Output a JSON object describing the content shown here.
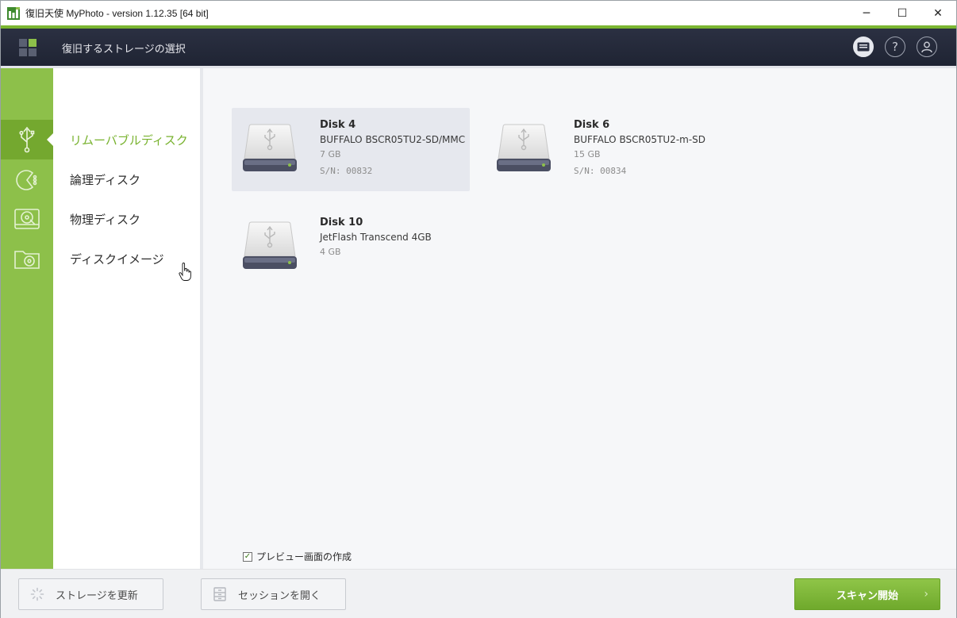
{
  "window": {
    "title": "復旧天使 MyPhoto - version 1.12.35 [64 bit]",
    "minimize_glyph": "─",
    "maximize_glyph": "☐",
    "close_glyph": "✕"
  },
  "header": {
    "title": "復旧するストレージの選択",
    "buttons": [
      "card-icon",
      "help-icon",
      "user-icon"
    ],
    "help_glyph": "?"
  },
  "sidebar": {
    "rail_icons": [
      "usb-icon",
      "pie-chart-icon",
      "hard-disk-icon",
      "disk-image-icon"
    ],
    "items": [
      {
        "label": "リムーバブルディスク",
        "active": true
      },
      {
        "label": "論理ディスク",
        "active": false
      },
      {
        "label": "物理ディスク",
        "active": false
      },
      {
        "label": "ディスクイメージ",
        "active": false
      }
    ]
  },
  "disks": [
    {
      "name": "Disk 4",
      "model": "BUFFALO BSCR05TU2-SD/MMC",
      "size": "7 GB",
      "serial": "S/N: 00832",
      "selected": true
    },
    {
      "name": "Disk 6",
      "model": "BUFFALO BSCR05TU2-m-SD",
      "size": "15 GB",
      "serial": "S/N: 00834",
      "selected": false
    },
    {
      "name": "Disk 10",
      "model": "JetFlash Transcend 4GB",
      "size": "4 GB",
      "serial": "",
      "selected": false
    }
  ],
  "options": {
    "preview_label": "プレビュー画面の作成",
    "preview_checked": true
  },
  "footer": {
    "refresh_label": "ストレージを更新",
    "session_label": "セッションを開く",
    "scan_label": "スキャン開始",
    "scan_arrow": "›"
  },
  "colors": {
    "accent_green": "#7bb631",
    "header_dark": "#242938"
  }
}
